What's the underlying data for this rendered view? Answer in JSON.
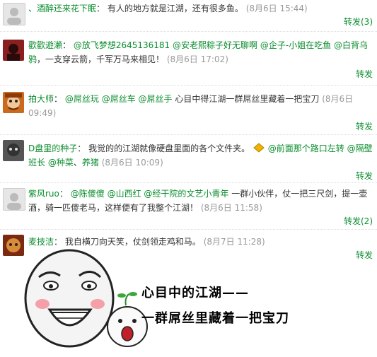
{
  "comments": [
    {
      "name": "、酒醉还来花下眠",
      "text": "有人的地方就是江湖，还有很多鱼。",
      "time": "(8月6日 15:44)",
      "forward": "转发(3)"
    },
    {
      "name": "歡歡遊瀨",
      "ats": [
        "@放飞梦想2645136181",
        "@安老熙粽子好无聊啊",
        "@企子-小姐在吃鱼",
        "@白背乌鸦"
      ],
      "text": "，一支穿云箭，千军万马来相见！",
      "time": "(8月6日 17:02)",
      "forward": "转发"
    },
    {
      "name": "拍大师",
      "ats": [
        "@屌丝玩",
        "@屌丝车",
        "@屌丝手"
      ],
      "text": "心目中得江湖一群屌丝里藏着一把宝刀",
      "time": "(8月6日",
      "time2": "09:49)",
      "forward": "转发"
    },
    {
      "name": "D盘里的种子",
      "text": "我觉的的江湖就像硬盘里面的各个文件夹。",
      "ats": [
        "@前面那个路口左转",
        "@隔壁班长",
        "@种菜",
        "养猪"
      ],
      "time": "(8月6日 10:09)",
      "forward": "转发"
    },
    {
      "name": "紫风ruo",
      "ats": [
        "@陈傻傻",
        "@山西红",
        "@经干院的文艺小青年"
      ],
      "text": "一群小伙伴，仗一把三尺剑，提一壶酒，骑一匹傻老马，这样便有了我整个江湖！",
      "time": "(8月6日 11:58)",
      "forward": "转发(2)"
    },
    {
      "name": "麦技洁",
      "text": "我自横刀向天笑，仗剑领走鸡和马。",
      "time": "(8月7日 11:28)",
      "forward": "转发"
    }
  ],
  "meme": {
    "line1": "心目中的江湖——",
    "line2": "一群屌丝里藏着一把宝刀"
  },
  "colors": {
    "link": "#0a8c2d",
    "time": "#999999"
  }
}
